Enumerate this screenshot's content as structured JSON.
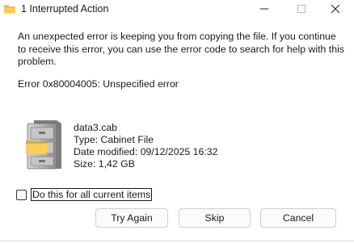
{
  "window": {
    "title": "1 Interrupted Action",
    "app_icon": "folder-icon",
    "controls": {
      "minimize": "minimize-icon",
      "maximize": "maximize-icon",
      "close": "close-icon"
    }
  },
  "dialog": {
    "message": "An unexpected error is keeping you from copying the file. If you continue to receive this error, you can use the error code to search for help with this problem.",
    "error_code": "Error 0x80004005: Unspecified error"
  },
  "file": {
    "icon": "cabinet-file-icon",
    "name": "data3.cab",
    "type": "Type: Cabinet File",
    "date_modified": "Date modified: 09/12/2025 16:32",
    "size": "Size: 1,42 GB"
  },
  "checkbox": {
    "label": "Do this for all current items",
    "checked": false
  },
  "buttons": {
    "try_again": "Try Again",
    "skip": "Skip",
    "cancel": "Cancel"
  },
  "colors": {
    "folder": "#f2c14e",
    "cabinet": "#9a9a9a",
    "button_border": "#cfcfcf"
  }
}
